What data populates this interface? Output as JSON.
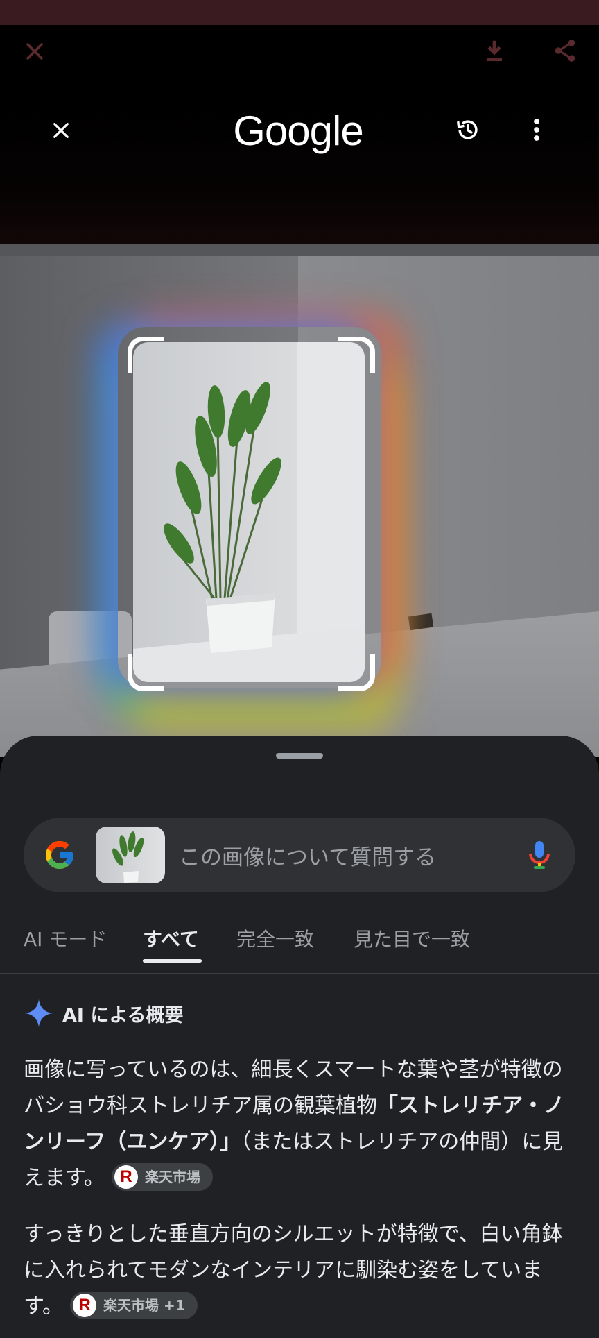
{
  "viewer_toolbar": {
    "close_icon": "close-icon",
    "download_icon": "download-icon",
    "share_icon": "share-icon"
  },
  "lens_header": {
    "logo_text": "Google",
    "close_icon": "close-icon",
    "history_icon": "history-icon",
    "more_icon": "more-vert-icon"
  },
  "search": {
    "placeholder": "この画像について質問する",
    "mic_icon": "mic-icon"
  },
  "tabs": [
    {
      "label": "AI モード",
      "active": false
    },
    {
      "label": "すべて",
      "active": true
    },
    {
      "label": "完全一致",
      "active": false
    },
    {
      "label": "見た目で一致",
      "active": false
    }
  ],
  "ai_overview": {
    "title": "AI による概要",
    "paragraph1_a": "画像に写っているのは、細長くスマートな葉や茎が特徴のバショウ科ストレリチア属の観葉植物",
    "paragraph1_bold": "「ストレリチア・ノンリーフ（ユンケア）」",
    "paragraph1_b": "（またはストレリチアの仲間）に見えます。",
    "paragraph1_chip": "楽天市場",
    "paragraph2": "すっきりとした垂直方向のシルエットが特徴で、白い角鉢に入れられてモダンなインテリアに馴染む姿をしています。",
    "paragraph2_chip": "楽天市場 +1",
    "chip_logo": "R"
  },
  "colors": {
    "sheet_bg": "#202124",
    "searchbox_bg": "#303134",
    "rakuten_red": "#bf0000"
  }
}
